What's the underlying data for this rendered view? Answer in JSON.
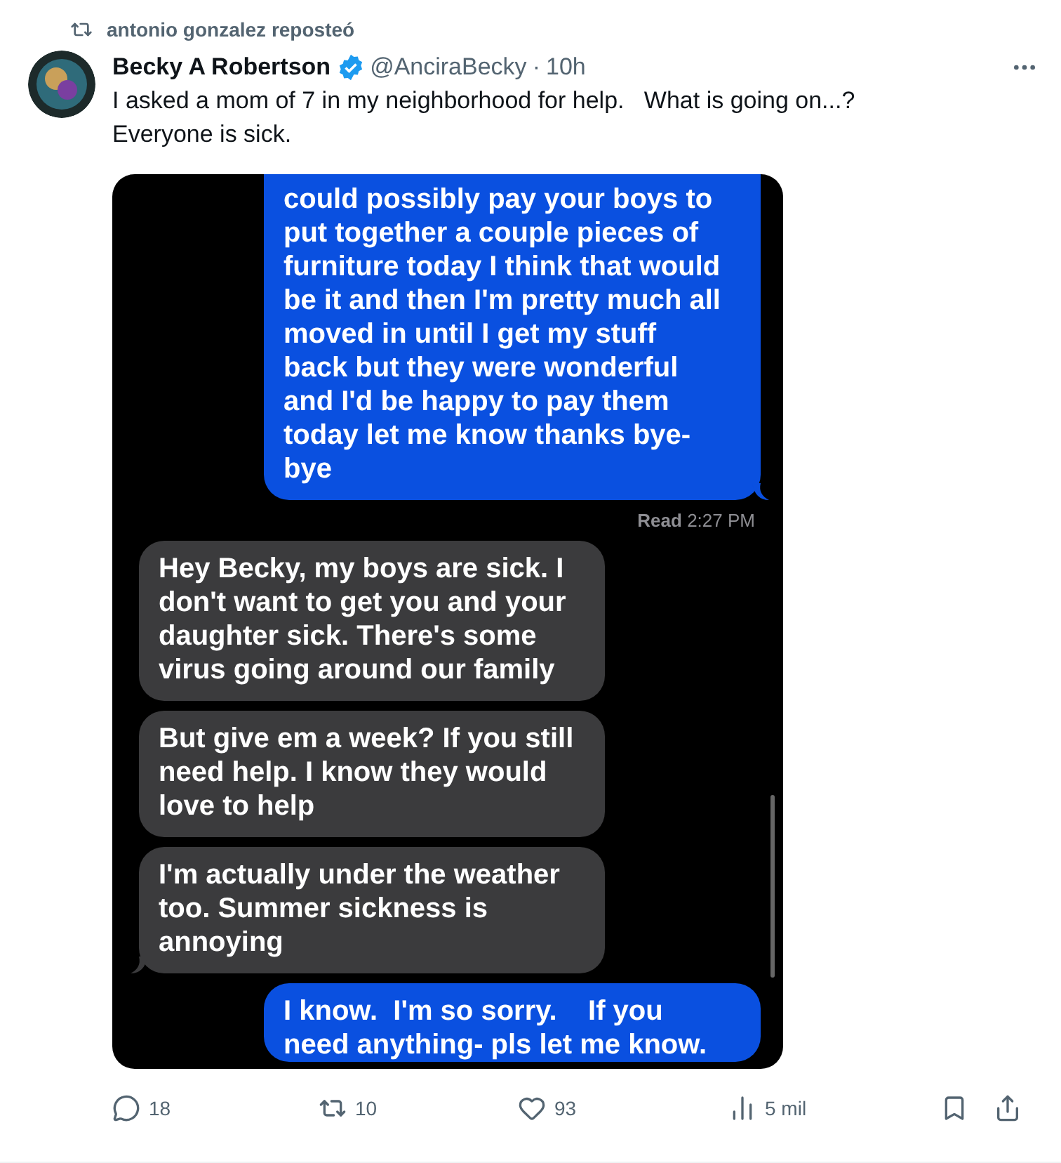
{
  "repost": {
    "label": "antonio gonzalez reposteó"
  },
  "post": {
    "name": "Becky A Robertson",
    "verified": true,
    "handle": "@AnciraBecky",
    "separator": "·",
    "time": "10h",
    "text": "I asked a mom of 7 in my neighborhood for help.   What is going on...?\nEveryone is sick."
  },
  "conversation": {
    "messages": [
      {
        "kind": "sent",
        "text": "could possibly pay your boys to\nput together a couple pieces of\nfurniture today I think that would\nbe it and then I'm pretty much all\nmoved in until I get my stuff\nback but they were wonderful\nand I'd be happy to pay them\ntoday let me know thanks bye-\nbye",
        "tail": true,
        "cut_top": true
      },
      {
        "kind": "receipt",
        "label": "Read",
        "time": "2:27 PM"
      },
      {
        "kind": "received",
        "text": "Hey Becky, my boys are sick. I\ndon't want to get you and your\ndaughter sick. There's some\nvirus going around our family",
        "tail": false
      },
      {
        "kind": "received",
        "text": "But give em a week? If you still\nneed help. I know they would\nlove to help",
        "tail": false
      },
      {
        "kind": "received",
        "text": "I'm actually under the weather\ntoo. Summer sickness is\nannoying",
        "tail": true
      },
      {
        "kind": "sent",
        "text": "I know.  I'm so sorry.    If you\nneed anything- pls let me know.",
        "tail": false,
        "cut_top": false
      }
    ]
  },
  "actions": [
    {
      "kind": "reply",
      "count": "18"
    },
    {
      "kind": "repost",
      "count": "10"
    },
    {
      "kind": "like",
      "count": "93"
    },
    {
      "kind": "views",
      "count": "5 mil"
    }
  ]
}
